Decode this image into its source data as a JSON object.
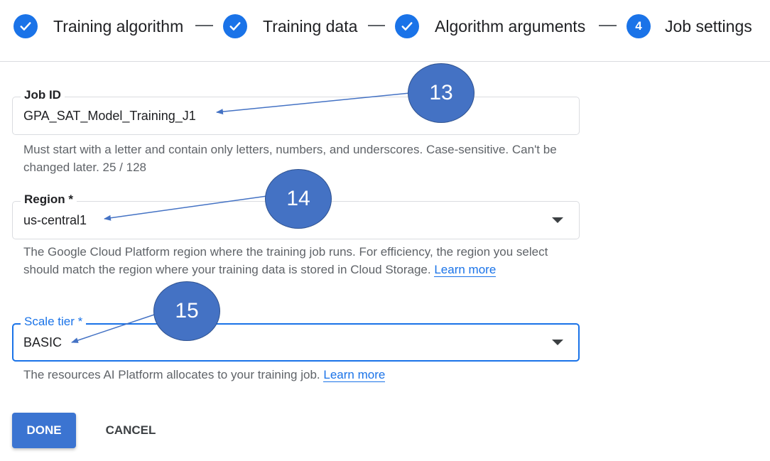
{
  "stepper": {
    "steps": [
      {
        "label": "Training algorithm",
        "state": "done",
        "icon": "check-icon"
      },
      {
        "label": "Training data",
        "state": "done",
        "icon": "check-icon"
      },
      {
        "label": "Algorithm arguments",
        "state": "done",
        "icon": "check-icon"
      },
      {
        "label": "Job settings",
        "state": "current",
        "number": "4"
      }
    ]
  },
  "form": {
    "job_id": {
      "label": "Job ID",
      "value": "GPA_SAT_Model_Training_J1",
      "hint": "Must start with a letter and contain only letters, numbers, and underscores. Case-sensitive. Can't be changed later. 25 / 128"
    },
    "region": {
      "label": "Region *",
      "value": "us-central1",
      "hint": "The Google Cloud Platform region where the training job runs. For efficiency, the region you select should match the region where your training data is stored in Cloud Storage.",
      "link": "Learn more"
    },
    "scale_tier": {
      "label": "Scale tier *",
      "value": "BASIC",
      "hint": "The resources AI Platform allocates to your training job.",
      "link": "Learn more"
    }
  },
  "buttons": {
    "done": "DONE",
    "cancel": "CANCEL"
  },
  "annotations": [
    {
      "number": "13",
      "points_to": "job-id-value"
    },
    {
      "number": "14",
      "points_to": "region-value"
    },
    {
      "number": "15",
      "points_to": "scale-tier-value"
    }
  ],
  "colors": {
    "accent": "#1a73e8",
    "callout_fill": "#4472c4",
    "done_button": "#3b74d1"
  }
}
